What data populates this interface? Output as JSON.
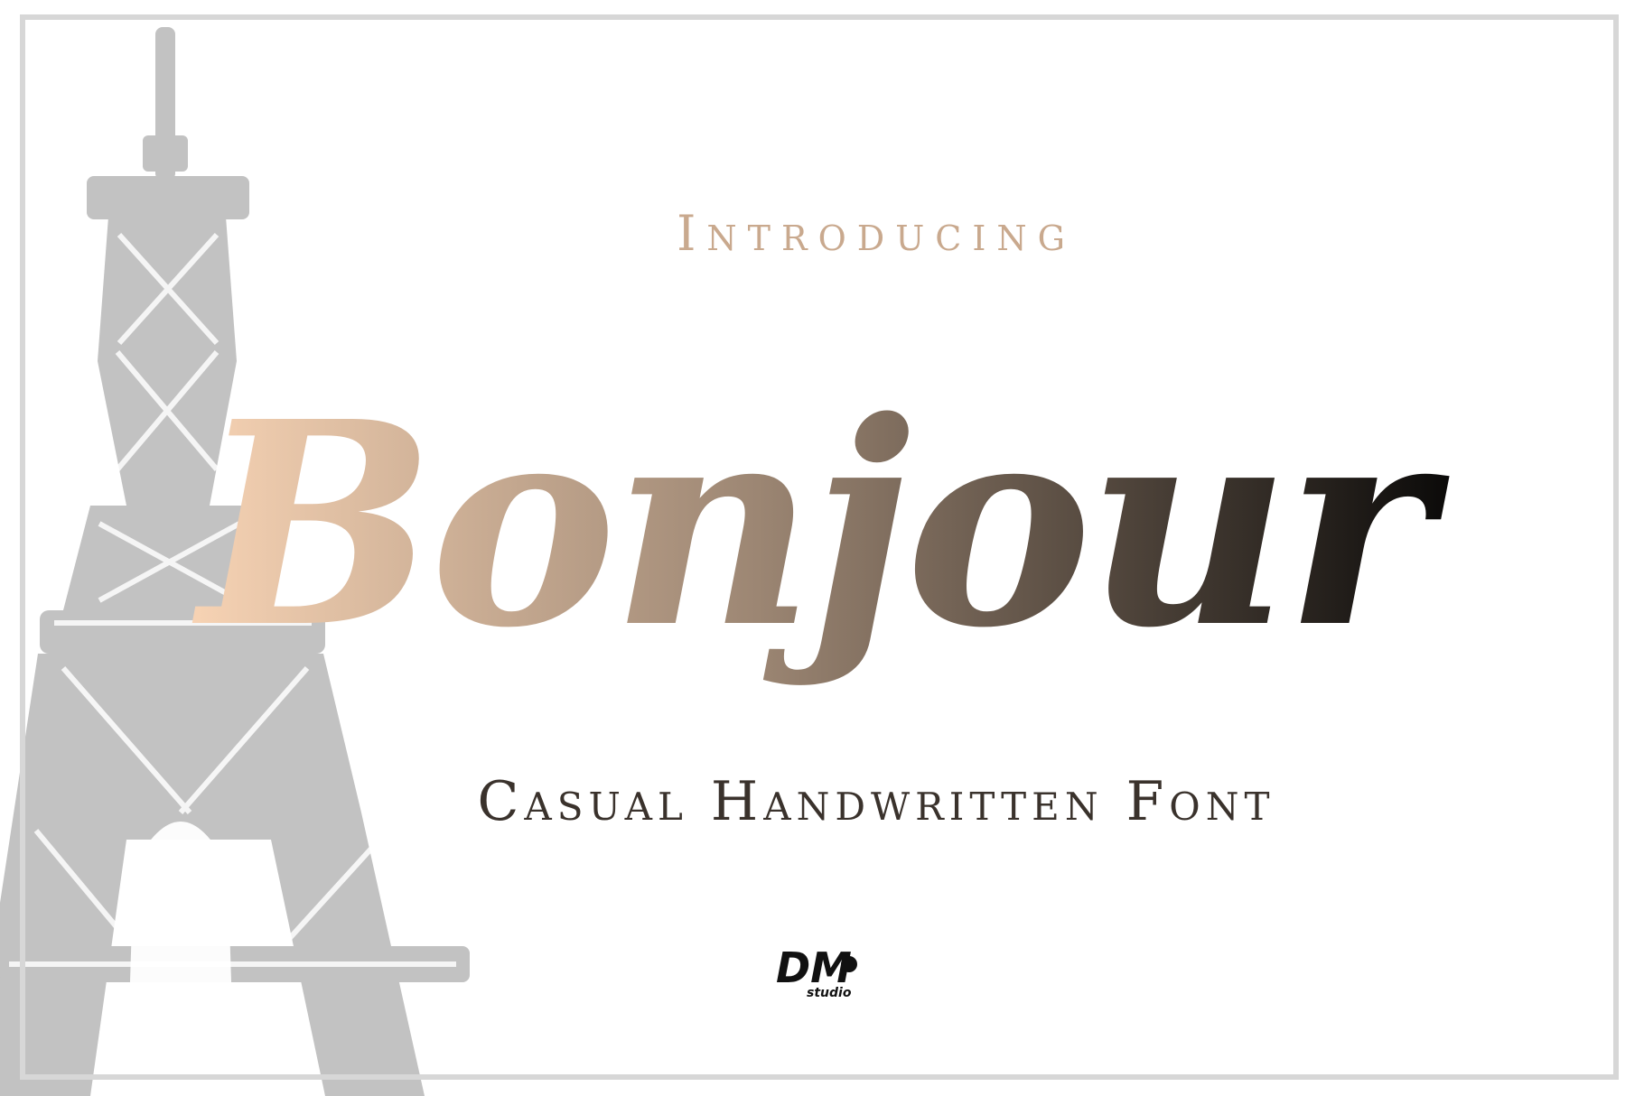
{
  "headline": {
    "eyebrow": "Introducing",
    "title": "Bonjour",
    "subtitle": "Casual Handwritten Font"
  },
  "logo": {
    "mark": "DM",
    "tag": "studio"
  },
  "colors": {
    "frame": "#d7d7d7",
    "tower": "#bdbdbd",
    "eyebrow": "#c9a98e",
    "title_start": "#f7d3b4",
    "title_mid": "#9c8673",
    "title_end": "#0b0a09",
    "subtitle": "#3a322c"
  },
  "icons": {
    "tower": "eiffel-tower-icon",
    "logo": "dm-studio-logo"
  }
}
